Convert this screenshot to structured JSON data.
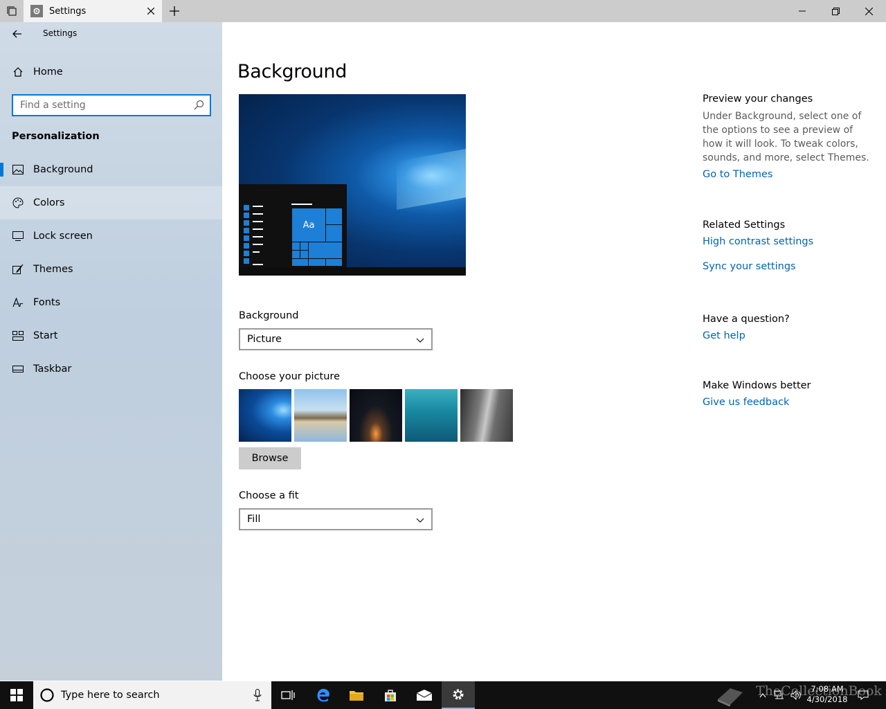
{
  "window": {
    "tab_title": "Settings",
    "app_title": "Settings"
  },
  "sidebar": {
    "home_label": "Home",
    "search_placeholder": "Find a setting",
    "section": "Personalization",
    "items": [
      {
        "label": "Background",
        "icon": "picture-icon",
        "selected": true
      },
      {
        "label": "Colors",
        "icon": "palette-icon"
      },
      {
        "label": "Lock screen",
        "icon": "lock-screen-icon"
      },
      {
        "label": "Themes",
        "icon": "themes-brush-icon"
      },
      {
        "label": "Fonts",
        "icon": "fonts-icon"
      },
      {
        "label": "Start",
        "icon": "start-icon"
      },
      {
        "label": "Taskbar",
        "icon": "taskbar-icon"
      }
    ]
  },
  "main": {
    "title": "Background",
    "preview_tile_text": "Aa",
    "background_label": "Background",
    "background_value": "Picture",
    "choose_picture_label": "Choose your picture",
    "browse_label": "Browse",
    "fit_label": "Choose a fit",
    "fit_value": "Fill"
  },
  "right": {
    "preview_head": "Preview your changes",
    "preview_text": "Under Background, select one of the options to see a preview of how it will look. To tweak colors, sounds, and more, select Themes.",
    "go_themes": "Go to Themes",
    "related_head": "Related Settings",
    "high_contrast": "High contrast settings",
    "sync": "Sync your settings",
    "question_head": "Have a question?",
    "get_help": "Get help",
    "better_head": "Make Windows better",
    "feedback": "Give us feedback"
  },
  "taskbar": {
    "search_placeholder": "Type here to search",
    "time": "7:08 AM",
    "date": "4/30/2018",
    "watermark": "TheCollectionBook"
  },
  "colors": {
    "accent": "#0078d7",
    "link": "#0063b1"
  }
}
